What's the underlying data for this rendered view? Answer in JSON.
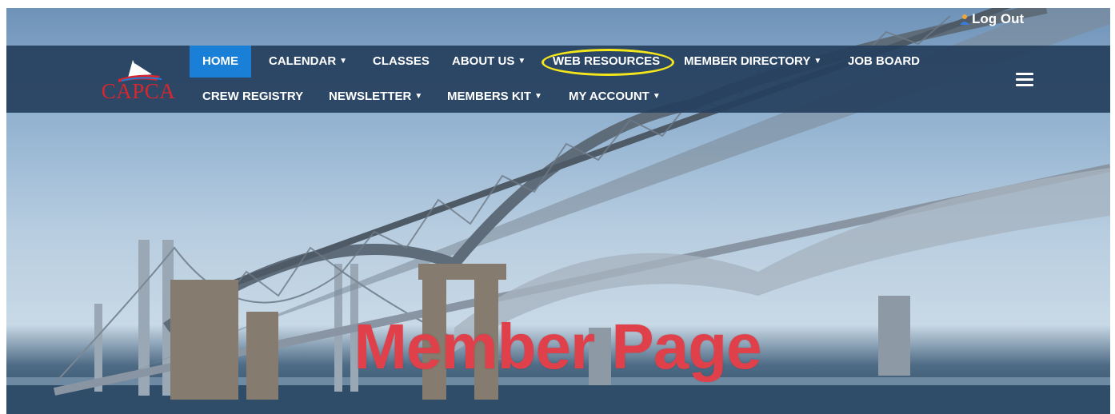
{
  "header": {
    "logout_label": "Log Out"
  },
  "logo": {
    "text": "CAPCA"
  },
  "nav": {
    "row1": [
      {
        "label": "HOME",
        "dropdown": false,
        "active": true
      },
      {
        "label": "CALENDAR",
        "dropdown": true
      },
      {
        "label": "CLASSES",
        "dropdown": false
      },
      {
        "label": "ABOUT US",
        "dropdown": true
      },
      {
        "label": "WEB RESOURCES",
        "dropdown": false,
        "highlighted": true
      },
      {
        "label": "MEMBER DIRECTORY",
        "dropdown": true
      },
      {
        "label": "JOB BOARD",
        "dropdown": false
      }
    ],
    "row2": [
      {
        "label": "CREW REGISTRY",
        "dropdown": false
      },
      {
        "label": "NEWSLETTER",
        "dropdown": true
      },
      {
        "label": "MEMBERS KIT",
        "dropdown": true
      },
      {
        "label": "MY ACCOUNT",
        "dropdown": true
      }
    ],
    "menu_icon": "hamburger-icon"
  },
  "hero": {
    "title": "Member Page"
  },
  "colors": {
    "nav_bg": "#26405e",
    "active": "#1a7fd6",
    "highlight_ring": "#f3e71c",
    "title": "#e0404a",
    "logo_red": "#d7262e"
  }
}
